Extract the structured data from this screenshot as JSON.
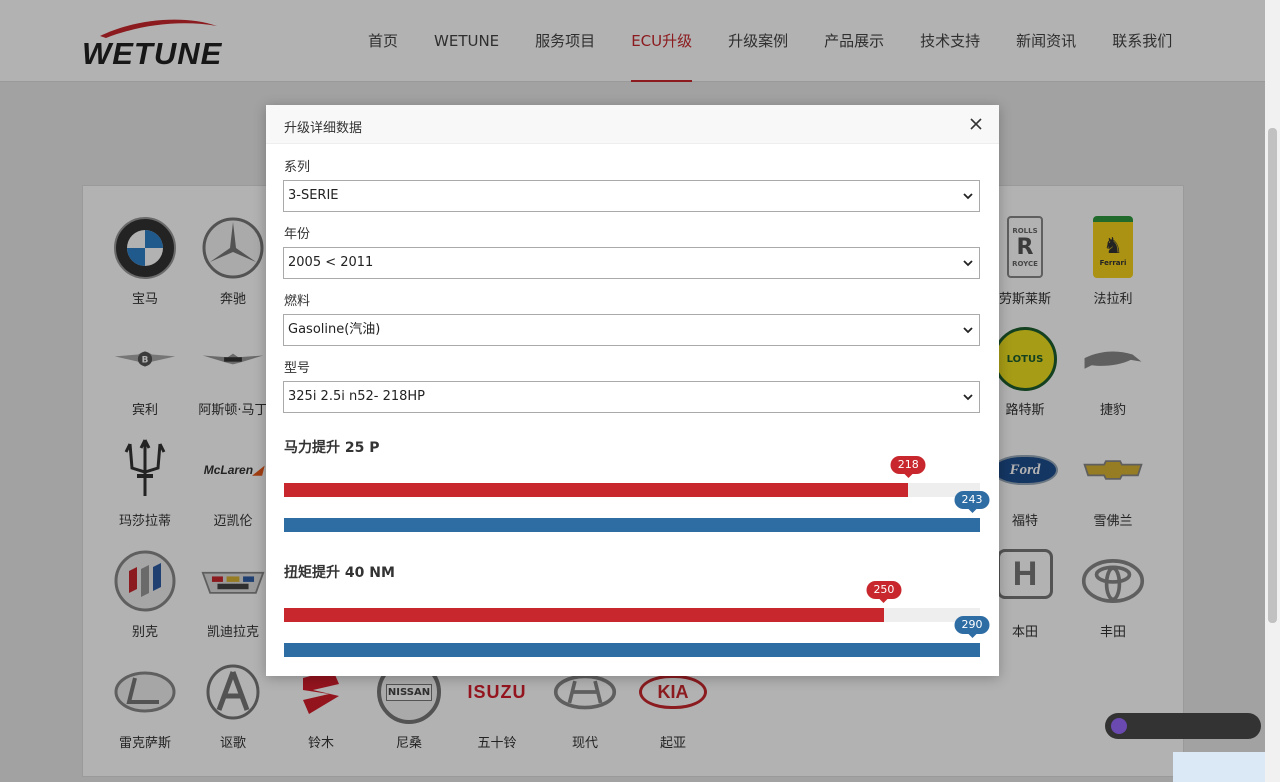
{
  "header": {
    "logo_text": "WETUNE",
    "nav": [
      {
        "label": "首页"
      },
      {
        "label": "WETUNE"
      },
      {
        "label": "服务项目"
      },
      {
        "label": "ECU升级",
        "active": true
      },
      {
        "label": "升级案例"
      },
      {
        "label": "产品展示"
      },
      {
        "label": "技术支持"
      },
      {
        "label": "新闻资讯"
      },
      {
        "label": "联系我们"
      }
    ]
  },
  "brands": [
    {
      "name": "宝马"
    },
    {
      "name": "奔驰"
    },
    {
      "name": "劳斯莱斯"
    },
    {
      "name": "法拉利"
    },
    {
      "name": "宾利"
    },
    {
      "name": "阿斯顿·马丁"
    },
    {
      "name": "路特斯"
    },
    {
      "name": "捷豹"
    },
    {
      "name": "玛莎拉蒂"
    },
    {
      "name": "迈凯伦"
    },
    {
      "name": "福特"
    },
    {
      "name": "雪佛兰"
    },
    {
      "name": "别克"
    },
    {
      "name": "凯迪拉克"
    },
    {
      "name": "本田"
    },
    {
      "name": "丰田"
    },
    {
      "name": "雷克萨斯"
    },
    {
      "name": "讴歌"
    },
    {
      "name": "铃木"
    },
    {
      "name": "尼桑"
    },
    {
      "name": "五十铃"
    },
    {
      "name": "现代"
    },
    {
      "name": "起亚"
    }
  ],
  "brand_logo_text": {
    "mclaren": "McLaren",
    "nissan": "NISSAN",
    "isuzu": "ISUZU",
    "kia": "KIA",
    "lotus": "LOTUS",
    "ford": "Ford",
    "rolls_top": "ROLLS",
    "rolls_bottom": "ROYCE",
    "ferrari": "Ferrari"
  },
  "modal": {
    "title": "升级详细数据",
    "fields": [
      {
        "label": "系列",
        "value": "3-SERIE"
      },
      {
        "label": "年份",
        "value": "2005 < 2011"
      },
      {
        "label": "燃料",
        "value": "Gasoline(汽油)"
      },
      {
        "label": "型号",
        "value": "325i 2.5i n52- 218HP"
      }
    ],
    "power": {
      "label": "马力提升 25 P",
      "before": "218",
      "after": "243",
      "before_fraction": 0.897,
      "after_fraction": 1.0
    },
    "torque": {
      "label": "扭矩提升 40 NM",
      "before": "250",
      "after": "290",
      "before_fraction": 0.862,
      "after_fraction": 1.0
    }
  },
  "colors": {
    "accent": "#c8282d",
    "bar_before": "#c8282d",
    "bar_after": "#2e6ca4"
  }
}
